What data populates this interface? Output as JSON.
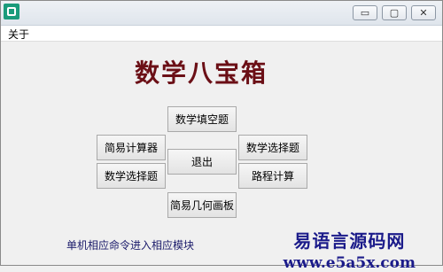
{
  "window": {
    "menu": [
      "关于"
    ],
    "app_title": "数学八宝箱",
    "buttons": {
      "fill_blank": "数学填空题",
      "calculator": "简易计算器",
      "exit": "退出",
      "choice_left": "数学选择题",
      "choice_right": "数学选择题",
      "route_calc": "路程计算",
      "geometry": "简易几何画板"
    },
    "hint": "单机相应命令进入相应模块",
    "watermark": {
      "line1": "易语言源码网",
      "line2": "www.e5a5x.com"
    },
    "controls": {
      "minimize": "▭",
      "maximize": "▢",
      "close": "✕"
    }
  }
}
